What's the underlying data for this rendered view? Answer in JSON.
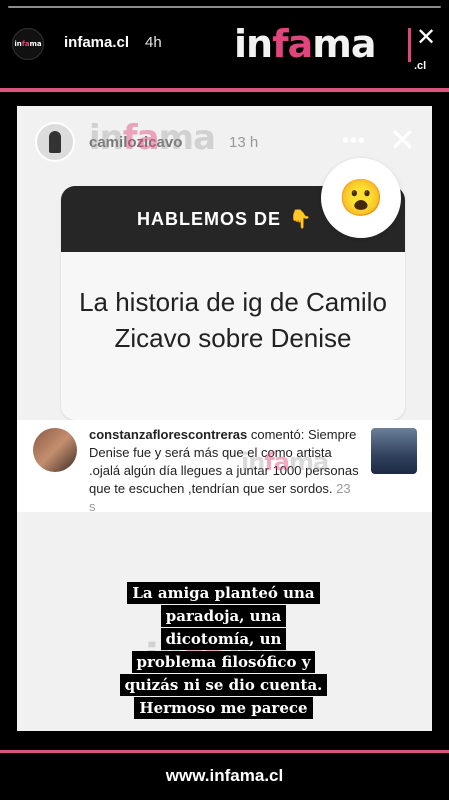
{
  "story": {
    "account_name": "infama.cl",
    "time_ago": "4h",
    "brand": {
      "pre": "in",
      "accent": "fa",
      "post": "ma",
      "suffix": ".cl"
    },
    "footer_url": "www.infama.cl",
    "colors": {
      "accent": "#e0457b",
      "background": "#000000"
    }
  },
  "inner": {
    "username": "camilozicavo",
    "time_ago": "13 h",
    "question_header": "HABLEMOS DE",
    "question_header_emoji": "👇",
    "question_body": "La historia de ig de Camilo Zicavo sobre Denise",
    "reaction_emoji": "😮",
    "comment": {
      "user": "constanzaflorescontreras",
      "verb": "comentó:",
      "text": "Siempre Denise fue y será más que el como artista .ojalá algún día llegues a juntar 1000 personas que te escuchen ,tendrían que ser sordos.",
      "time": "23 s"
    }
  },
  "caption_lines": [
    "La amiga planteó una",
    "paradoja, una",
    "dicotomía, un",
    "problema filosófico y",
    "quizás ni se dio cuenta.",
    "Hermoso me parece"
  ]
}
